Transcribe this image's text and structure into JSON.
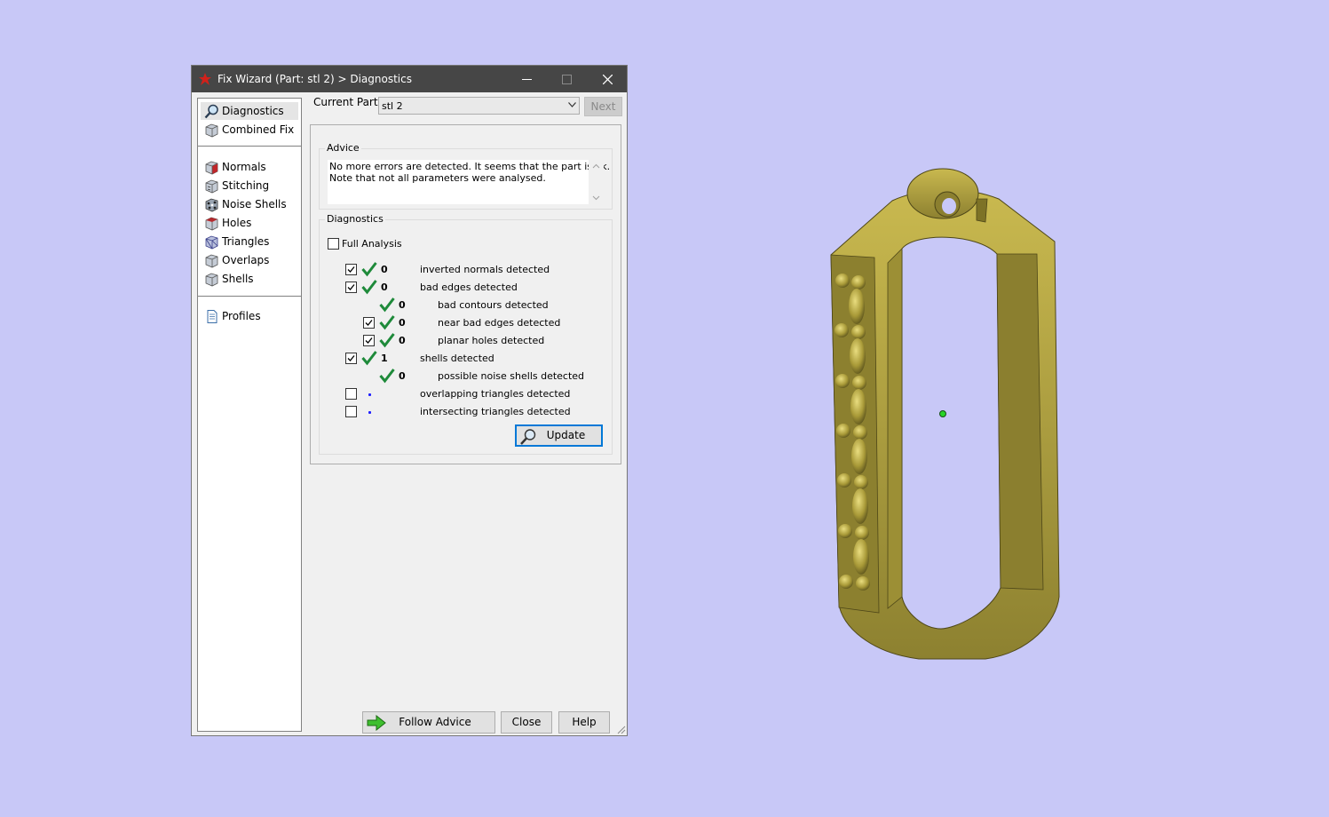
{
  "window": {
    "title": "Fix Wizard (Part: stl 2) > Diagnostics",
    "controls": [
      "minimize",
      "maximize",
      "close"
    ]
  },
  "sidebar": {
    "items": [
      {
        "label": "Diagnostics",
        "icon": "magnifier-icon",
        "selected": true
      },
      {
        "label": "Combined Fix",
        "icon": "cube-icon"
      },
      {
        "label": "Normals",
        "icon": "normals-cube-icon"
      },
      {
        "label": "Stitching",
        "icon": "stitching-cube-icon"
      },
      {
        "label": "Noise Shells",
        "icon": "noise-shells-icon"
      },
      {
        "label": "Holes",
        "icon": "holes-cube-icon"
      },
      {
        "label": "Triangles",
        "icon": "triangles-icon"
      },
      {
        "label": "Overlaps",
        "icon": "overlaps-cube-icon"
      },
      {
        "label": "Shells",
        "icon": "shells-cube-icon"
      },
      {
        "label": "Profiles",
        "icon": "document-icon"
      }
    ]
  },
  "part": {
    "label": "Current Part:",
    "value": "stl 2",
    "next_label": "Next"
  },
  "advice": {
    "heading": "Advice",
    "text": "No more errors are detected. It seems that the part is ok.\nNote that not all parameters were analysed."
  },
  "diagnostics": {
    "heading": "Diagnostics",
    "full_analysis_label": "Full Analysis",
    "full_analysis_checked": false,
    "rows": [
      {
        "checkbox": true,
        "checked": true,
        "status": "ok",
        "count": "0",
        "label": "inverted normals detected",
        "indent": 0
      },
      {
        "checkbox": true,
        "checked": true,
        "status": "ok",
        "count": "0",
        "label": "bad edges detected",
        "indent": 0
      },
      {
        "checkbox": false,
        "checked": false,
        "status": "ok",
        "count": "0",
        "label": "bad contours detected",
        "indent": 1
      },
      {
        "checkbox": true,
        "checked": true,
        "status": "ok",
        "count": "0",
        "label": "near bad edges detected",
        "indent": 1
      },
      {
        "checkbox": true,
        "checked": true,
        "status": "ok",
        "count": "0",
        "label": "planar holes detected",
        "indent": 1
      },
      {
        "checkbox": true,
        "checked": true,
        "status": "ok",
        "count": "1",
        "label": "shells detected",
        "indent": 0
      },
      {
        "checkbox": false,
        "checked": false,
        "status": "ok",
        "count": "0",
        "label": "possible noise shells detected",
        "indent": 1
      },
      {
        "checkbox": true,
        "checked": false,
        "status": "unknown",
        "count": "",
        "label": "overlapping triangles detected",
        "indent": 0
      },
      {
        "checkbox": true,
        "checked": false,
        "status": "unknown",
        "count": "",
        "label": "intersecting triangles detected",
        "indent": 0
      }
    ],
    "update_label": "Update"
  },
  "footer": {
    "follow_advice_label": "Follow Advice",
    "close_label": "Close",
    "help_label": "Help"
  },
  "colors": {
    "desktop": "#c8c8f7",
    "titlebar": "#464646",
    "model_gold": "#a99a38",
    "tick_green": "#1e8a3a",
    "focus_blue": "#0078d7"
  }
}
